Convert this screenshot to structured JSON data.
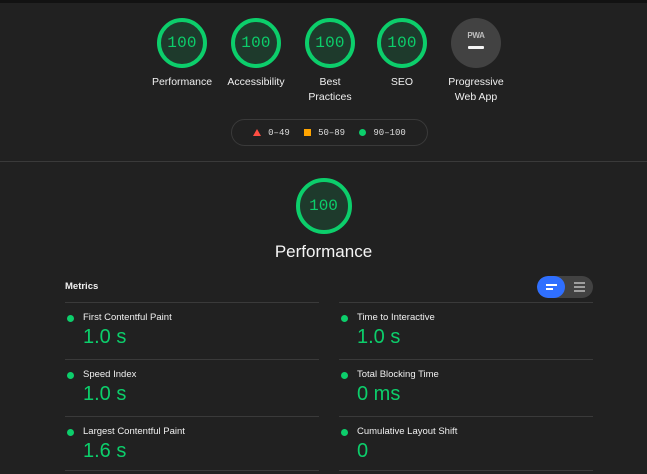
{
  "colors": {
    "pass": "#0cce6b",
    "average": "#ffa400",
    "fail": "#ff4e42",
    "background": "#212121",
    "toggle_active": "#2f6fff"
  },
  "categories": [
    {
      "score": "100",
      "label": "Performance"
    },
    {
      "score": "100",
      "label": "Accessibility"
    },
    {
      "score": "100",
      "label": "Best Practices"
    },
    {
      "score": "100",
      "label": "SEO"
    }
  ],
  "pwa": {
    "badge": "PWA",
    "label": "Progressive Web App"
  },
  "legend": {
    "fail": "0–49",
    "average": "50–89",
    "pass": "90–100"
  },
  "main": {
    "score": "100",
    "title": "Performance"
  },
  "metrics": {
    "heading": "Metrics",
    "items": [
      {
        "name": "First Contentful Paint",
        "value": "1.0 s"
      },
      {
        "name": "Time to Interactive",
        "value": "1.0 s"
      },
      {
        "name": "Speed Index",
        "value": "1.0 s"
      },
      {
        "name": "Total Blocking Time",
        "value": "0 ms"
      },
      {
        "name": "Largest Contentful Paint",
        "value": "1.6 s"
      },
      {
        "name": "Cumulative Layout Shift",
        "value": "0"
      }
    ]
  }
}
